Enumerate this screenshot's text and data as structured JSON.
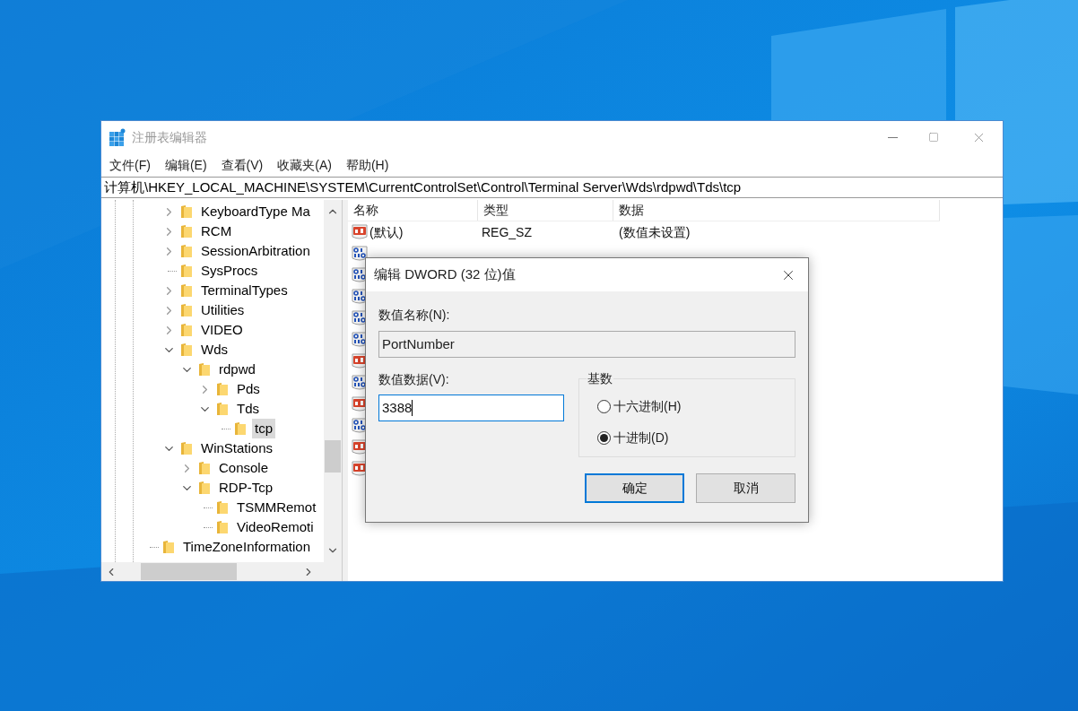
{
  "window": {
    "title": "注册表编辑器",
    "menu": [
      "文件(F)",
      "编辑(E)",
      "查看(V)",
      "收藏夹(A)",
      "帮助(H)"
    ],
    "address": "计算机\\HKEY_LOCAL_MACHINE\\SYSTEM\\CurrentControlSet\\Control\\Terminal Server\\Wds\\rdpwd\\Tds\\tcp",
    "tree": {
      "items": [
        {
          "children": [
            {
              "label": "KeyboardType Ma",
              "expanded": false,
              "selected": false
            },
            {
              "label": "RCM",
              "expanded": false,
              "selected": false
            },
            {
              "label": "SessionArbitration",
              "expanded": false,
              "selected": false
            },
            {
              "label": "SysProcs",
              "selected": false
            },
            {
              "label": "TerminalTypes",
              "expanded": false,
              "selected": false
            },
            {
              "label": "Utilities",
              "expanded": false,
              "selected": false
            },
            {
              "label": "VIDEO",
              "expanded": false,
              "selected": false
            },
            {
              "label": "Wds",
              "expanded": true,
              "selected": false,
              "children": [
                {
                  "label": "rdpwd",
                  "expanded": true,
                  "selected": false,
                  "children": [
                    {
                      "label": "Pds",
                      "expanded": false,
                      "selected": false
                    },
                    {
                      "label": "Tds",
                      "expanded": true,
                      "selected": false,
                      "children": [
                        {
                          "label": "tcp",
                          "selected": true
                        }
                      ]
                    }
                  ]
                }
              ]
            },
            {
              "label": "WinStations",
              "expanded": true,
              "selected": false,
              "children": [
                {
                  "label": "Console",
                  "expanded": false,
                  "selected": false
                },
                {
                  "label": "RDP-Tcp",
                  "expanded": true,
                  "selected": false,
                  "children": [
                    {
                      "label": "TSMMRemot",
                      "selected": false
                    },
                    {
                      "label": "VideoRemoti",
                      "selected": false
                    }
                  ]
                }
              ]
            }
          ]
        },
        {
          "label": "TimeZoneInformation",
          "selected": false
        }
      ]
    },
    "table": {
      "columns": [
        "名称",
        "类型",
        "数据"
      ],
      "rows": [
        {
          "kind": "string",
          "name": "(默认)",
          "type": "REG_SZ",
          "data": "(数值未设置)"
        },
        {
          "kind": "dword"
        },
        {
          "kind": "dword"
        },
        {
          "kind": "dword"
        },
        {
          "kind": "dword"
        },
        {
          "kind": "dword"
        },
        {
          "kind": "string"
        },
        {
          "kind": "dword"
        },
        {
          "kind": "string"
        },
        {
          "kind": "dword"
        },
        {
          "kind": "string"
        },
        {
          "kind": "string"
        }
      ]
    }
  },
  "dialog": {
    "title": "编辑 DWORD (32 位)值",
    "name_label": "数值名称(N):",
    "name_value": "PortNumber",
    "data_label": "数值数据(V):",
    "data_value": "3388",
    "base_label": "基数",
    "radios": [
      {
        "label": "十六进制(H)",
        "selected": false
      },
      {
        "label": "十进制(D)",
        "selected": true
      }
    ],
    "buttons": [
      {
        "label": "确定",
        "default": true
      },
      {
        "label": "取消",
        "default": false
      }
    ]
  }
}
